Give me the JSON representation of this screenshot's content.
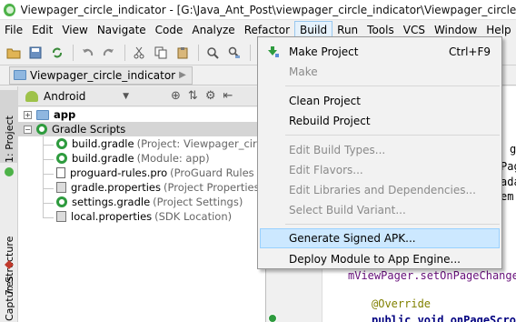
{
  "window": {
    "title": "Viewpager_circle_indicator - [G:\\Java_Ant_Post\\viewpager_circle_indicator\\Viewpager_circle_indicator]"
  },
  "menubar": {
    "items": [
      {
        "label": "File"
      },
      {
        "label": "Edit"
      },
      {
        "label": "View"
      },
      {
        "label": "Navigate"
      },
      {
        "label": "Code"
      },
      {
        "label": "Analyze"
      },
      {
        "label": "Refactor"
      },
      {
        "label": "Build"
      },
      {
        "label": "Run"
      },
      {
        "label": "Tools"
      },
      {
        "label": "VCS"
      },
      {
        "label": "Window"
      },
      {
        "label": "Help"
      }
    ],
    "active": "Build"
  },
  "navbar": {
    "breadcrumb": "Viewpager_circle_indicator"
  },
  "side_tabs": {
    "project": "1: Project",
    "structure": "7: Structure",
    "captures": "Captures"
  },
  "project_panel": {
    "view_selector": "Android",
    "tree": [
      {
        "name": "app",
        "hint": ""
      },
      {
        "name": "Gradle Scripts",
        "hint": ""
      },
      {
        "name": "build.gradle",
        "hint": "(Project: Viewpager_circle_indi"
      },
      {
        "name": "build.gradle",
        "hint": "(Module: app)"
      },
      {
        "name": "proguard-rules.pro",
        "hint": "(ProGuard Rules for ap"
      },
      {
        "name": "gradle.properties",
        "hint": "(Project Properties)"
      },
      {
        "name": "settings.gradle",
        "hint": "(Project Settings)"
      },
      {
        "name": "local.properties",
        "hint": "(SDK Location)"
      }
    ]
  },
  "editor": {
    "lines": [
      {
        "text": "g"
      },
      {
        "text": "Pag"
      },
      {
        "text": "ada"
      },
      {
        "text": "em("
      },
      {
        "text": "mViewPager.setOnPageChange"
      },
      {
        "text": "@Override"
      },
      {
        "text": "public void onPageScrol"
      }
    ]
  },
  "build_menu": {
    "items": [
      {
        "label": "Make Project",
        "shortcut": "Ctrl+F9",
        "enabled": true
      },
      {
        "label": "Make",
        "shortcut": "",
        "enabled": false
      },
      {
        "label": "Clean Project",
        "shortcut": "",
        "enabled": true
      },
      {
        "label": "Rebuild Project",
        "shortcut": "",
        "enabled": true
      },
      {
        "label": "Edit Build Types...",
        "shortcut": "",
        "enabled": false
      },
      {
        "label": "Edit Flavors...",
        "shortcut": "",
        "enabled": false
      },
      {
        "label": "Edit Libraries and Dependencies...",
        "shortcut": "",
        "enabled": false
      },
      {
        "label": "Select Build Variant...",
        "shortcut": "",
        "enabled": false
      },
      {
        "label": "Generate Signed APK...",
        "shortcut": "",
        "enabled": true,
        "highlighted": true
      },
      {
        "label": "Deploy Module to App Engine...",
        "shortcut": "",
        "enabled": true
      }
    ]
  },
  "colors": {
    "menu_highlight": "#cce8ff",
    "gradle_green": "#2e9b3e",
    "field_purple": "#660e7a",
    "annotation_olive": "#808000",
    "keyword_navy": "#000080"
  }
}
